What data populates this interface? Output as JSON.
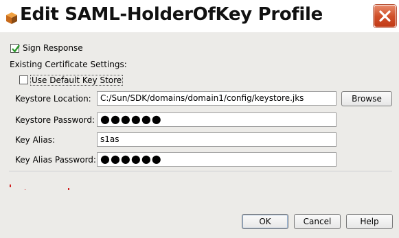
{
  "window": {
    "title": "Edit SAML-HolderOfKey Profile"
  },
  "options": {
    "sign_response_label": "Sign Response",
    "sign_response_checked": true,
    "existing_cert_heading": "Existing Certificate Settings:",
    "use_default_label": "Use Default Key Store",
    "use_default_checked": false
  },
  "fields": {
    "keystore_location_label": "Keystore Location:",
    "keystore_location_value": "C:/Sun/SDK/domains/domain1/config/keystore.jks",
    "keystore_password_label": "Keystore Password:",
    "keystore_password_value": "●●●●●●",
    "key_alias_label": "Key Alias:",
    "key_alias_value": "s1as",
    "key_alias_password_label": "Key Alias Password:",
    "key_alias_password_value": "●●●●●●"
  },
  "buttons": {
    "browse": "Browse",
    "ok": "OK",
    "cancel": "Cancel",
    "help": "Help"
  },
  "colors": {
    "dialog_bg": "#ecebe8",
    "close_button": "#d0502a",
    "checkmark": "#2e9a2e",
    "error_marks": "#d02020"
  }
}
